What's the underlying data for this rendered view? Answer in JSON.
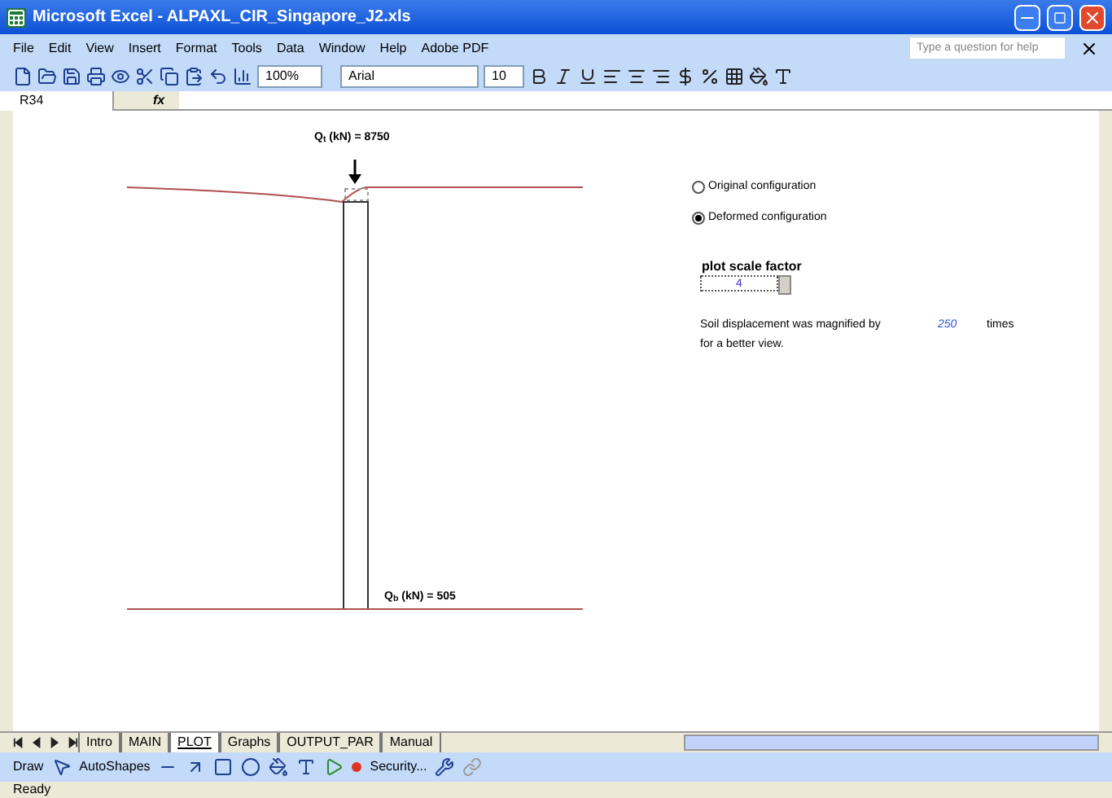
{
  "window": {
    "title": "Microsoft Excel - ALPAXL_CIR_Singapore_J2.xls"
  },
  "menu": [
    "File",
    "Edit",
    "View",
    "Insert",
    "Format",
    "Tools",
    "Data",
    "Window",
    "Help",
    "Adobe PDF"
  ],
  "help_search": {
    "placeholder": "Type a question for help"
  },
  "toolbar": {
    "zoom": "100%",
    "font": "Arial",
    "font_size": "10"
  },
  "formula_bar": {
    "name_box": "R34",
    "function_label": "fx"
  },
  "plot": {
    "top_load": "Q$_{t}$ (kN) = 8750",
    "base_load": "Q$_{b}$ (kN) = 505"
  },
  "view_options": [
    {
      "label": "Original configuration",
      "selected": false
    },
    {
      "label": "Deformed configuration",
      "selected": true
    }
  ],
  "scale_factor": {
    "label": "plot scale factor",
    "value": "4"
  },
  "magnification": {
    "text": "Soil displacement was magnified by",
    "value": "250",
    "unit": "times",
    "note": "for a better view."
  },
  "sheet_tabs": [
    {
      "label": "Intro",
      "selected": false
    },
    {
      "label": "MAIN",
      "selected": false
    },
    {
      "label": "PLOT",
      "selected": true
    },
    {
      "label": "Graphs",
      "selected": false
    },
    {
      "label": "OUTPUT_PAR",
      "selected": false
    },
    {
      "label": "Manual",
      "selected": false
    }
  ],
  "draw_toolbar": {
    "draw": "Draw",
    "autoshapes": "AutoShapes",
    "security": "Security..."
  },
  "status_bar": {
    "text": "Ready"
  }
}
